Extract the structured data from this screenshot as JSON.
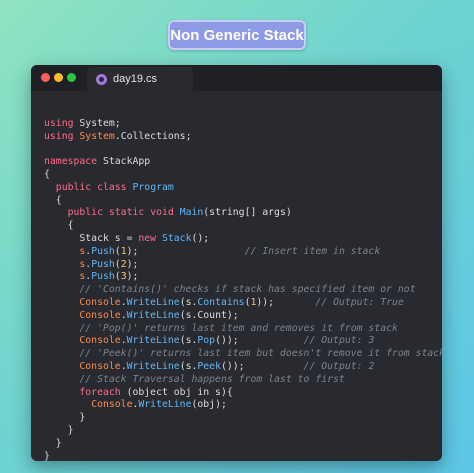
{
  "badge": {
    "title": "Non Generic Stack"
  },
  "window": {
    "tab_label": "day19.cs"
  },
  "code_lines": [
    [],
    [
      [
        "kw",
        "using"
      ],
      [
        "txt",
        " System;"
      ]
    ],
    [
      [
        "kw",
        "using"
      ],
      [
        "txt",
        " "
      ],
      [
        "ns",
        "System"
      ],
      [
        "txt",
        ".Collections;"
      ]
    ],
    [],
    [
      [
        "kw",
        "namespace"
      ],
      [
        "txt",
        " StackApp"
      ]
    ],
    [
      [
        "txt",
        "{"
      ]
    ],
    [
      [
        "txt",
        "  "
      ],
      [
        "kw",
        "public"
      ],
      [
        "txt",
        " "
      ],
      [
        "kw",
        "class"
      ],
      [
        "txt",
        " "
      ],
      [
        "type",
        "Program"
      ]
    ],
    [
      [
        "txt",
        "  {"
      ]
    ],
    [
      [
        "txt",
        "    "
      ],
      [
        "kw",
        "public"
      ],
      [
        "txt",
        " "
      ],
      [
        "kw",
        "static"
      ],
      [
        "txt",
        " "
      ],
      [
        "kw",
        "void"
      ],
      [
        "txt",
        " "
      ],
      [
        "fn",
        "Main"
      ],
      [
        "txt",
        "(string[] args)"
      ]
    ],
    [
      [
        "txt",
        "    {"
      ]
    ],
    [
      [
        "txt",
        "      Stack s = "
      ],
      [
        "kw",
        "new"
      ],
      [
        "txt",
        " "
      ],
      [
        "fn",
        "Stack"
      ],
      [
        "txt",
        "();"
      ]
    ],
    [
      [
        "txt",
        "      "
      ],
      [
        "ns",
        "s"
      ],
      [
        "txt",
        "."
      ],
      [
        "fn",
        "Push"
      ],
      [
        "txt",
        "("
      ],
      [
        "num",
        "1"
      ],
      [
        "txt",
        ");"
      ],
      [
        "cm",
        "                  // Insert item in stack"
      ]
    ],
    [
      [
        "txt",
        "      "
      ],
      [
        "ns",
        "s"
      ],
      [
        "txt",
        "."
      ],
      [
        "fn",
        "Push"
      ],
      [
        "txt",
        "("
      ],
      [
        "num",
        "2"
      ],
      [
        "txt",
        ");"
      ]
    ],
    [
      [
        "txt",
        "      "
      ],
      [
        "ns",
        "s"
      ],
      [
        "txt",
        "."
      ],
      [
        "fn",
        "Push"
      ],
      [
        "txt",
        "("
      ],
      [
        "num",
        "3"
      ],
      [
        "txt",
        ");"
      ]
    ],
    [
      [
        "cm",
        "      // 'Contains()' checks if stack has specified item or not"
      ]
    ],
    [
      [
        "txt",
        "      "
      ],
      [
        "ns",
        "Console"
      ],
      [
        "txt",
        "."
      ],
      [
        "fn",
        "WriteLine"
      ],
      [
        "txt",
        "(s."
      ],
      [
        "fn",
        "Contains"
      ],
      [
        "txt",
        "("
      ],
      [
        "num",
        "1"
      ],
      [
        "txt",
        "));"
      ],
      [
        "cm",
        "       // Output: True"
      ]
    ],
    [
      [
        "txt",
        "      "
      ],
      [
        "ns",
        "Console"
      ],
      [
        "txt",
        "."
      ],
      [
        "fn",
        "WriteLine"
      ],
      [
        "txt",
        "(s.Count);"
      ]
    ],
    [
      [
        "cm",
        "      // 'Pop()' returns last item and removes it from stack"
      ]
    ],
    [
      [
        "txt",
        "      "
      ],
      [
        "ns",
        "Console"
      ],
      [
        "txt",
        "."
      ],
      [
        "fn",
        "WriteLine"
      ],
      [
        "txt",
        "(s."
      ],
      [
        "fn",
        "Pop"
      ],
      [
        "txt",
        "());"
      ],
      [
        "cm",
        "           // Output: 3"
      ]
    ],
    [
      [
        "cm",
        "      // 'Peek()' returns last item but doesn't remove it from stack"
      ]
    ],
    [
      [
        "txt",
        "      "
      ],
      [
        "ns",
        "Console"
      ],
      [
        "txt",
        "."
      ],
      [
        "fn",
        "WriteLine"
      ],
      [
        "txt",
        "(s."
      ],
      [
        "fn",
        "Peek"
      ],
      [
        "txt",
        "());"
      ],
      [
        "cm",
        "          // Output: 2"
      ]
    ],
    [
      [
        "cm",
        "      // Stack Traversal happens from last to first"
      ]
    ],
    [
      [
        "txt",
        "      "
      ],
      [
        "kw",
        "foreach"
      ],
      [
        "txt",
        " (object obj in s){"
      ]
    ],
    [
      [
        "txt",
        "        "
      ],
      [
        "ns",
        "Console"
      ],
      [
        "txt",
        "."
      ],
      [
        "fn",
        "WriteLine"
      ],
      [
        "txt",
        "(obj);"
      ]
    ],
    [
      [
        "txt",
        "      }"
      ]
    ],
    [
      [
        "txt",
        "    }"
      ]
    ],
    [
      [
        "txt",
        "  }"
      ]
    ],
    [
      [
        "txt",
        "}"
      ]
    ]
  ]
}
